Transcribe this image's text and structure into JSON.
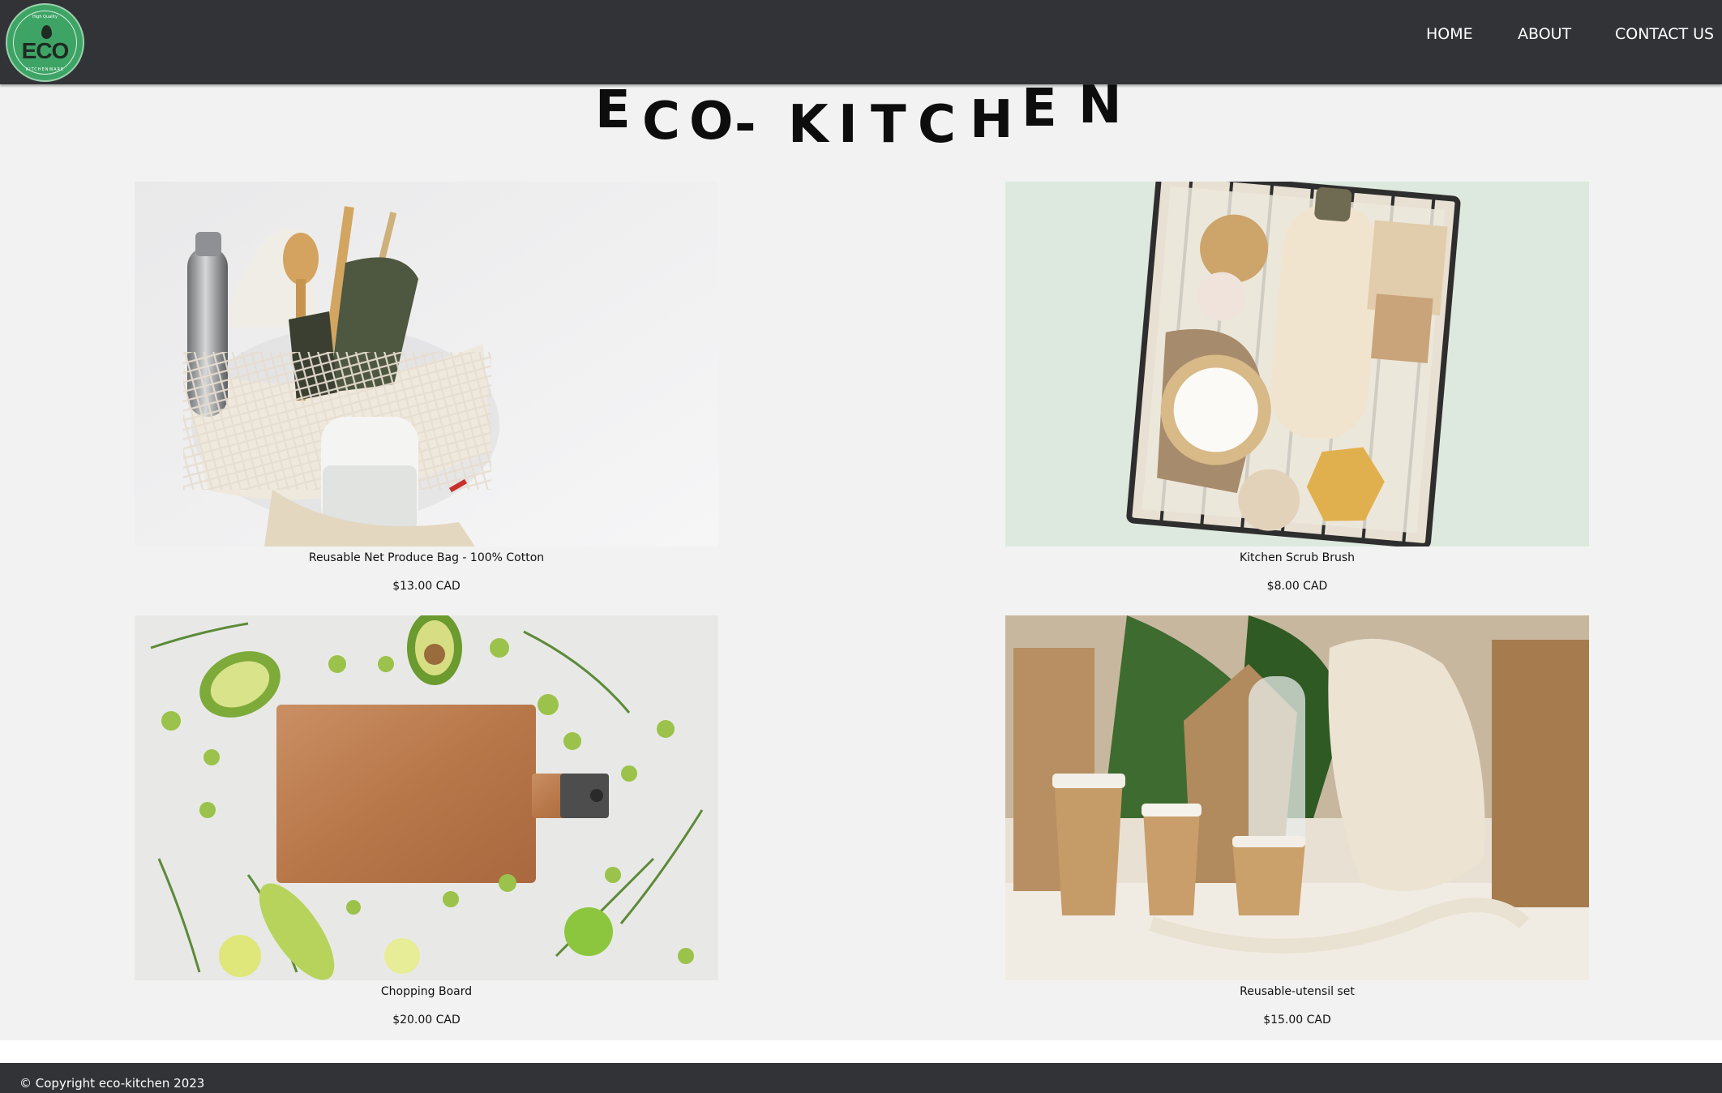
{
  "header": {
    "logo": {
      "top_text": "High Quality",
      "word": "ECO",
      "bottom_text": "KITCHENWARE",
      "icon": "leaf-icon"
    },
    "nav": [
      {
        "label": "HOME"
      },
      {
        "label": "ABOUT"
      },
      {
        "label": "CONTACT US"
      }
    ]
  },
  "brand": {
    "title": "ECO-KITCHEN"
  },
  "products": [
    {
      "name": "Reusable Net Produce Bag - 100% Cotton",
      "price": "$13.00 CAD",
      "image": "net-bag-photo"
    },
    {
      "name": "Kitchen Scrub Brush",
      "price": "$8.00 CAD",
      "image": "scrub-basket-photo"
    },
    {
      "name": "Chopping Board",
      "price": "$20.00 CAD",
      "image": "chopping-board-photo"
    },
    {
      "name": "Reusable-utensil set",
      "price": "$15.00 CAD",
      "image": "utensil-set-photo"
    }
  ],
  "footer": {
    "copyright": "© Copyright eco-kitchen 2023"
  },
  "colors": {
    "header_bg": "#323337",
    "page_bg": "#f2f2f2",
    "logo_green": "#3ea466"
  }
}
